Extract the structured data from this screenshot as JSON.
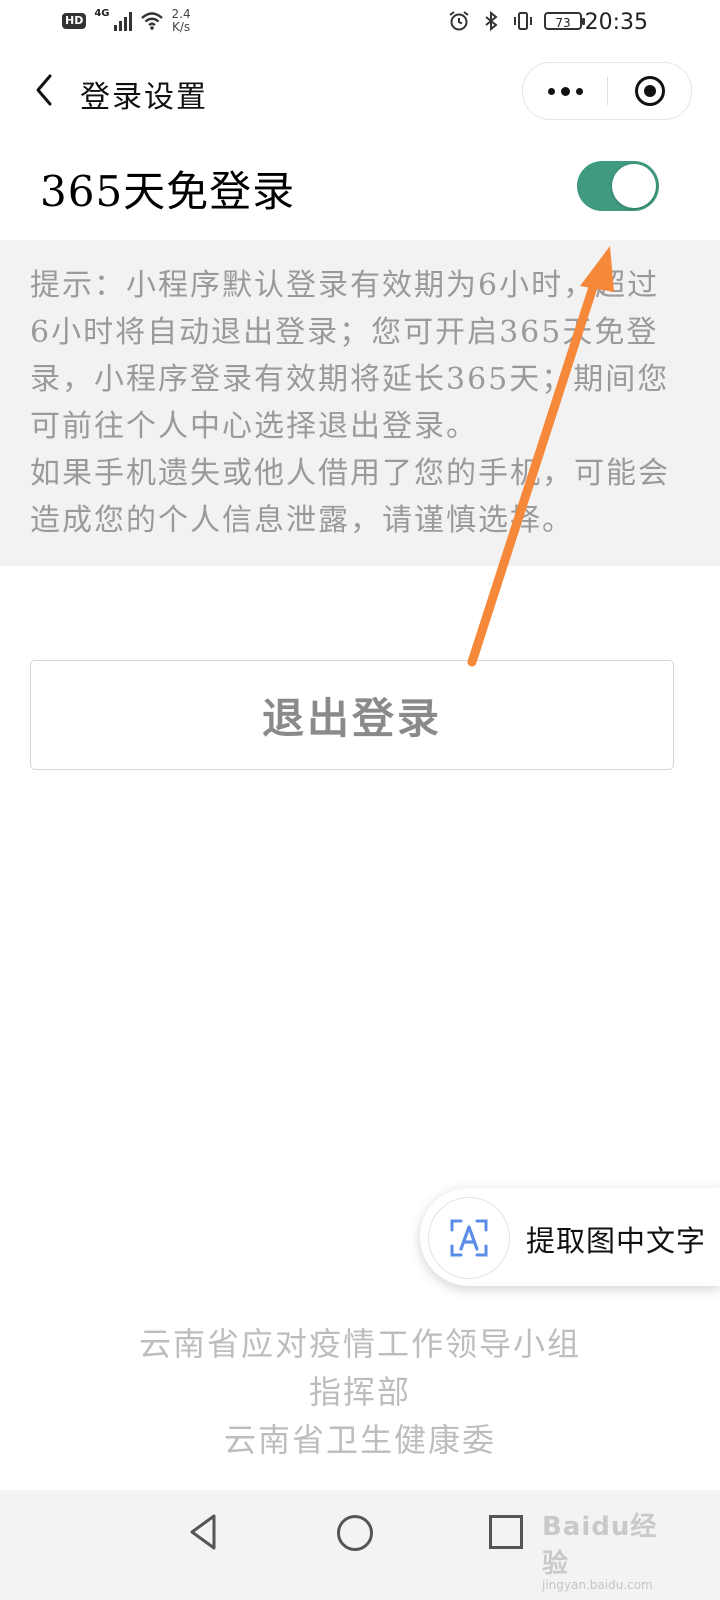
{
  "status_bar": {
    "hd": "HD",
    "network": "4G",
    "speed_value": "2.4",
    "speed_unit": "K/s",
    "battery": "73",
    "time": "20:35"
  },
  "nav": {
    "title": "登录设置"
  },
  "setting": {
    "label": "365天免登录",
    "toggle_on": true,
    "toggle_color": "#3f9a80"
  },
  "tip": {
    "para1": "提示：小程序默认登录有效期为6小时，超过6小时将自动退出登录；您可开启365天免登录，小程序登录有效期将延长365天；期间您可前往个人中心选择退出登录。",
    "para2": "如果手机遗失或他人借用了您的手机，可能会造成您的个人信息泄露，请谨慎选择。"
  },
  "logout_button": "退出登录",
  "ocr_float": {
    "label": "提取图中文字",
    "icon": "text-recognition-icon"
  },
  "footer": {
    "line1": "云南省应对疫情工作领导小组",
    "line2": "指挥部",
    "line3": "云南省卫生健康委"
  },
  "watermark": {
    "main": "Baidu经验",
    "sub": "jingyan.baidu.com"
  },
  "annotation": {
    "arrow_color": "#f6883a"
  }
}
